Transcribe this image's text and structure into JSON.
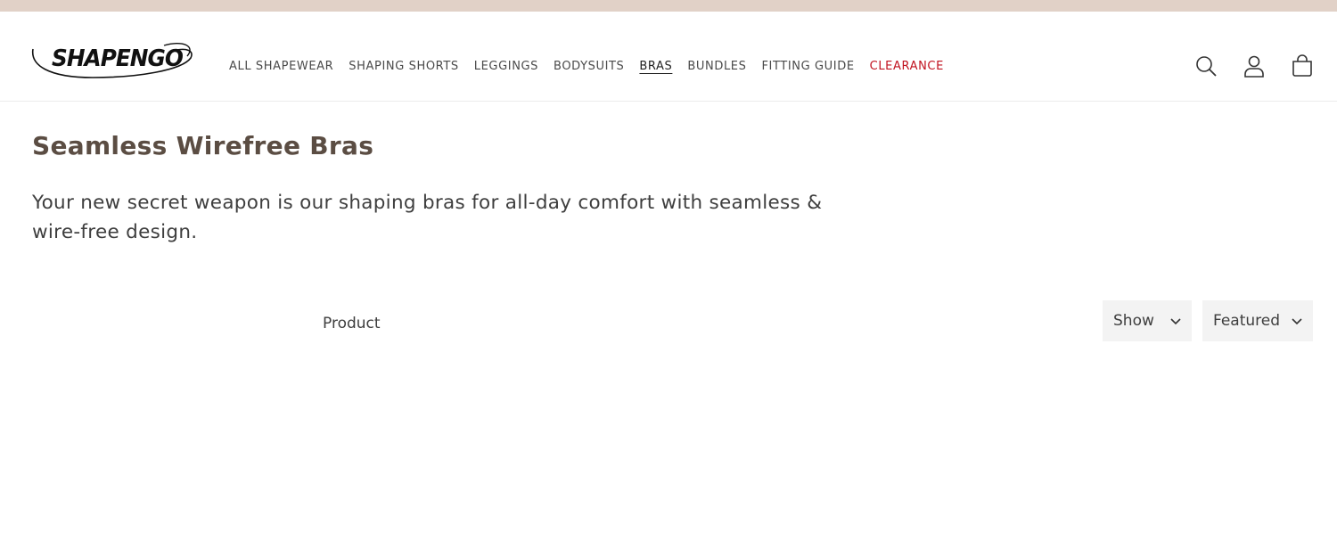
{
  "brand": {
    "logo_text": "SHAPENGO"
  },
  "nav": {
    "items": [
      {
        "label": "ALL SHAPEWEAR"
      },
      {
        "label": "SHAPING SHORTS"
      },
      {
        "label": "LEGGINGS"
      },
      {
        "label": "BODYSUITS"
      },
      {
        "label": "BRAS",
        "active": true
      },
      {
        "label": "BUNDLES"
      },
      {
        "label": "FITTING GUIDE"
      },
      {
        "label": "CLEARANCE",
        "color": "#c1121f"
      }
    ]
  },
  "header_icons": [
    "search-icon",
    "account-icon",
    "cart-icon"
  ],
  "page": {
    "title": "Seamless Wirefree Bras",
    "description": "Your new secret weapon is our shaping bras for all-day comfort with seamless & wire-free design."
  },
  "toolbar": {
    "product_label": "Product",
    "show_label": "Show",
    "sort_label": "Featured"
  },
  "colors": {
    "topbar": "#e1d1c7",
    "title": "#5b4d43",
    "sale": "#c1121f",
    "select_bg": "#f3f3f3"
  }
}
